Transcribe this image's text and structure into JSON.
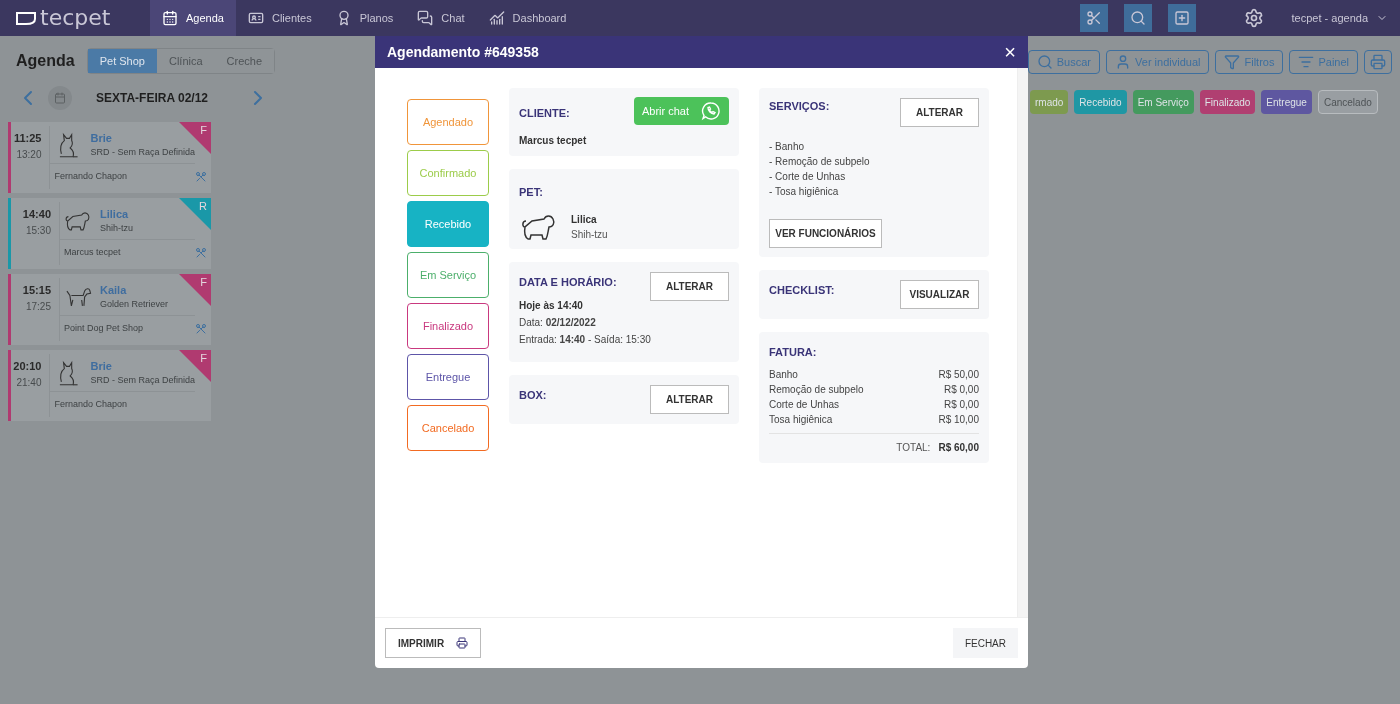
{
  "nav": {
    "logo": "tecpet",
    "items": [
      {
        "label": "Agenda",
        "selected": true
      },
      {
        "label": "Clientes",
        "selected": false
      },
      {
        "label": "Planos",
        "selected": false
      },
      {
        "label": "Chat",
        "selected": false
      },
      {
        "label": "Dashboard",
        "selected": false
      }
    ],
    "user": "tecpet - agenda"
  },
  "agenda": {
    "title": "Agenda",
    "tabs": [
      {
        "label": "Pet Shop",
        "selected": true
      },
      {
        "label": "Clínica",
        "selected": false
      },
      {
        "label": "Creche",
        "selected": false
      }
    ],
    "date": "SEXTA-FEIRA 02/12",
    "toolbar": [
      "Buscar",
      "Ver individual",
      "Filtros",
      "Painel"
    ],
    "status_chips": [
      {
        "label": "rmado",
        "color": "#7d9a4f",
        "outlined": false
      },
      {
        "label": "Recebido",
        "color": "#1f97a4",
        "outlined": false
      },
      {
        "label": "Em Serviço",
        "color": "#449a5e",
        "outlined": false
      },
      {
        "label": "Finalizado",
        "color": "#b03f71",
        "outlined": false
      },
      {
        "label": "Entregue",
        "color": "#5e57a0",
        "outlined": false
      },
      {
        "label": "Cancelado",
        "color": "#999ea2",
        "outlined": true
      }
    ],
    "appointments": [
      {
        "start": "11:25",
        "end": "13:20",
        "pet": "Brie",
        "breed": "SRD - Sem Raça Definida",
        "owner": "Fernando Chapon",
        "badge": "F",
        "color": "#b03a70",
        "kind": "cat",
        "grooming": true
      },
      {
        "start": "14:40",
        "end": "15:30",
        "pet": "Lilica",
        "breed": "Shih-tzu",
        "owner": "Marcus tecpet",
        "badge": "R",
        "color": "#1a98a8",
        "kind": "small-dog",
        "grooming": true
      },
      {
        "start": "15:15",
        "end": "17:25",
        "pet": "Kaila",
        "breed": "Golden Retriever",
        "owner": "Point Dog Pet Shop",
        "badge": "F",
        "color": "#b03a70",
        "kind": "dog",
        "grooming": true
      },
      {
        "start": "20:10",
        "end": "21:40",
        "pet": "Brie",
        "breed": "SRD - Sem Raça Definida",
        "owner": "Fernando Chapon",
        "badge": "F",
        "color": "#b03a70",
        "kind": "cat",
        "grooming": false
      }
    ]
  },
  "modal": {
    "title": "Agendamento #649358",
    "close": "×",
    "statuses": [
      {
        "label": "Agendado",
        "color": "#f0953a",
        "selected": false
      },
      {
        "label": "Confirmado",
        "color": "#9ccc4a",
        "selected": false
      },
      {
        "label": "Recebido",
        "color": "#17b3c4",
        "selected": true
      },
      {
        "label": "Em Serviço",
        "color": "#4caf6b",
        "selected": false
      },
      {
        "label": "Finalizado",
        "color": "#c9397f",
        "selected": false
      },
      {
        "label": "Entregue",
        "color": "#5d55a8",
        "selected": false
      },
      {
        "label": "Cancelado",
        "color": "#f26b22",
        "selected": false
      }
    ],
    "client": {
      "label": "CLIENTE:",
      "name": "Marcus tecpet",
      "chat_button": "Abrir chat"
    },
    "pet": {
      "label": "PET:",
      "name": "Lilica",
      "breed": "Shih-tzu",
      "kind": "small-dog"
    },
    "schedule": {
      "label": "DATA E HORÁRIO:",
      "button": "ALTERAR",
      "headline": "Hoje às 14:40",
      "lines": [
        "Data: **02/12/2022**",
        "Entrada: **14:40** - Saída: 15:30"
      ]
    },
    "box": {
      "label": "BOX:",
      "button": "ALTERAR"
    },
    "services": {
      "label": "SERVIÇOS:",
      "button": "ALTERAR",
      "items": [
        "- Banho",
        "- Remoção de subpelo",
        "- Corte de Unhas",
        "- Tosa higiênica"
      ],
      "staff_button": "VER FUNCIONÁRIOS"
    },
    "checklist": {
      "label": "CHECKLIST:",
      "button": "VISUALIZAR"
    },
    "invoice": {
      "label": "FATURA:",
      "items": [
        {
          "name": "Banho",
          "amount": "R$ 50,00"
        },
        {
          "name": "Remoção de subpelo",
          "amount": "R$ 0,00"
        },
        {
          "name": "Corte de Unhas",
          "amount": "R$ 0,00"
        },
        {
          "name": "Tosa higiênica",
          "amount": "R$ 10,00"
        }
      ],
      "total_label": "TOTAL:",
      "total": "R$ 60,00"
    },
    "print_button": "IMPRIMIR",
    "close_button": "FECHAR"
  }
}
